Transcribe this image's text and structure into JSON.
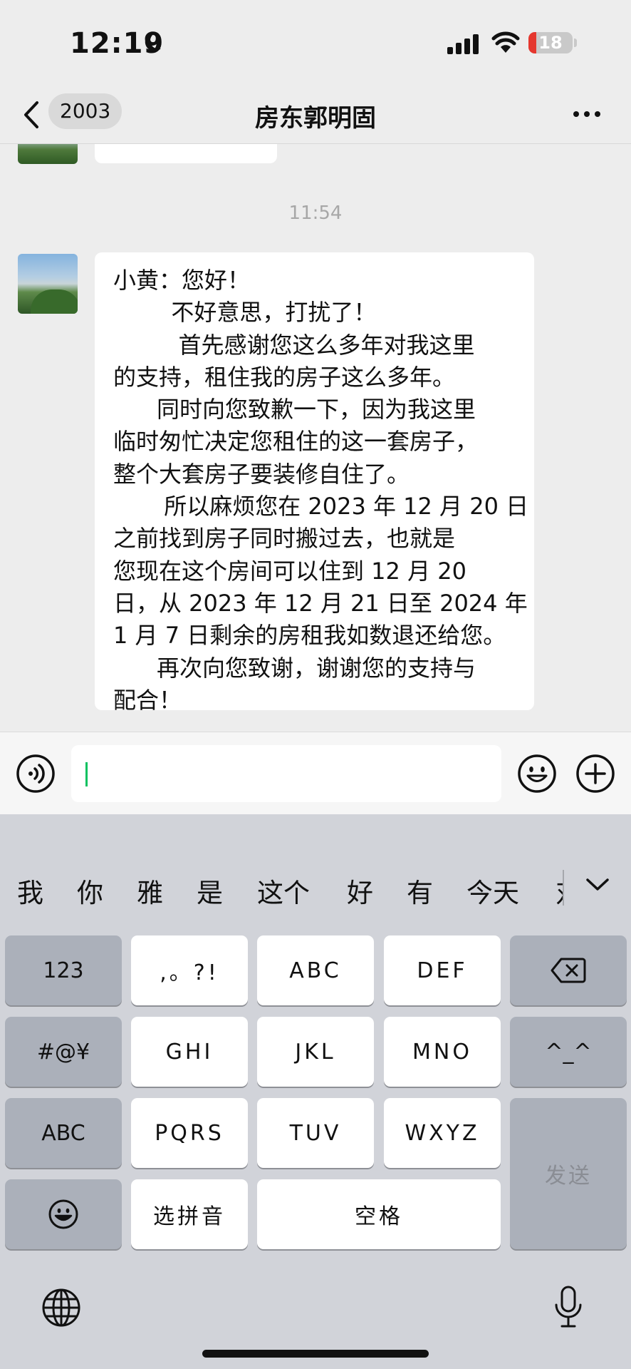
{
  "status_bar": {
    "time": "12:19",
    "battery": "18",
    "icons": [
      "moon-icon",
      "cellular-signal-icon",
      "wifi-icon",
      "battery-icon"
    ]
  },
  "nav": {
    "unread_count": "2003",
    "title": "房东郭明固",
    "icons": [
      "back-chevron-icon",
      "more-options-icon"
    ]
  },
  "conversation": {
    "timestamp": "11:54",
    "message_lines": [
      "小黄：您好！",
      "        不好意思，打扰了！",
      "         首先感谢您这么多年对我这里",
      "的支持，租住我的房子这么多年。",
      "      同时向您致歉一下，因为我这里",
      "临时匆忙决定您租住的这一套房子，",
      "整个大套房子要装修自住了。",
      "       所以麻烦您在 2023 年 12 月 20 日",
      "之前找到房子同时搬过去，也就是",
      "您现在这个房间可以住到 12 月 20",
      "日，从 2023 年 12 月 21 日至 2024 年",
      "1 月 7 日剩余的房租我如数退还给您。",
      "      再次向您致谢，谢谢您的支持与",
      "配合！"
    ]
  },
  "input_bar": {
    "value": "",
    "icons": [
      "voice-input-icon",
      "emoji-icon",
      "add-plus-icon"
    ]
  },
  "keyboard": {
    "candidates": [
      "我",
      "你",
      "雅",
      "是",
      "这个",
      "好",
      "有",
      "今天",
      "对"
    ],
    "keys": {
      "numbers": "123",
      "punctuation": ",。?!",
      "abc": "ABC",
      "def": "DEF",
      "symbols": "#@¥",
      "ghi": "GHI",
      "jkl": "JKL",
      "mno": "MNO",
      "emoticon": "^_^",
      "abc_switch": "ABC",
      "pqrs": "PQRS",
      "tuv": "TUV",
      "wxyz": "WXYZ",
      "send": "发送",
      "pinyin": "选拼音",
      "space": "空格"
    },
    "icons": [
      "delete-backspace-icon",
      "smiley-icon",
      "globe-icon",
      "microphone-icon",
      "collapse-chevron-icon"
    ]
  },
  "colors": {
    "chat_background": "#ededed",
    "bubble": "#ffffff",
    "keyboard": "#d1d3d9",
    "function_key": "#abb0ba",
    "cursor": "#07c160",
    "battery_low": "#e5372e"
  }
}
